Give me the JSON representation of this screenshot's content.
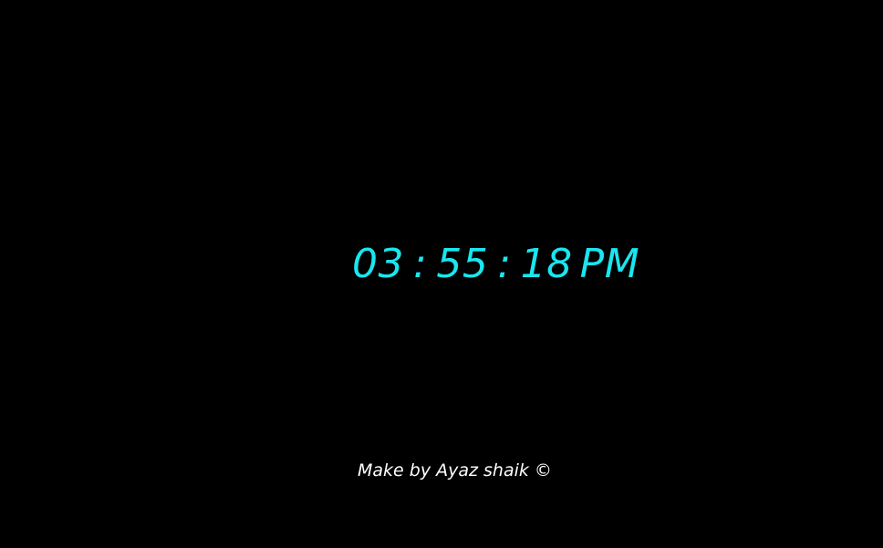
{
  "clock": {
    "hours": "03",
    "separator_1": ":",
    "minutes": "55",
    "separator_2": ":",
    "seconds": "18",
    "period": "PM"
  },
  "footer": {
    "credit": "Make by Ayaz shaik ©"
  },
  "colors": {
    "background": "#000000",
    "clock_text": "#19e6f0",
    "footer_text": "#ffffff"
  }
}
